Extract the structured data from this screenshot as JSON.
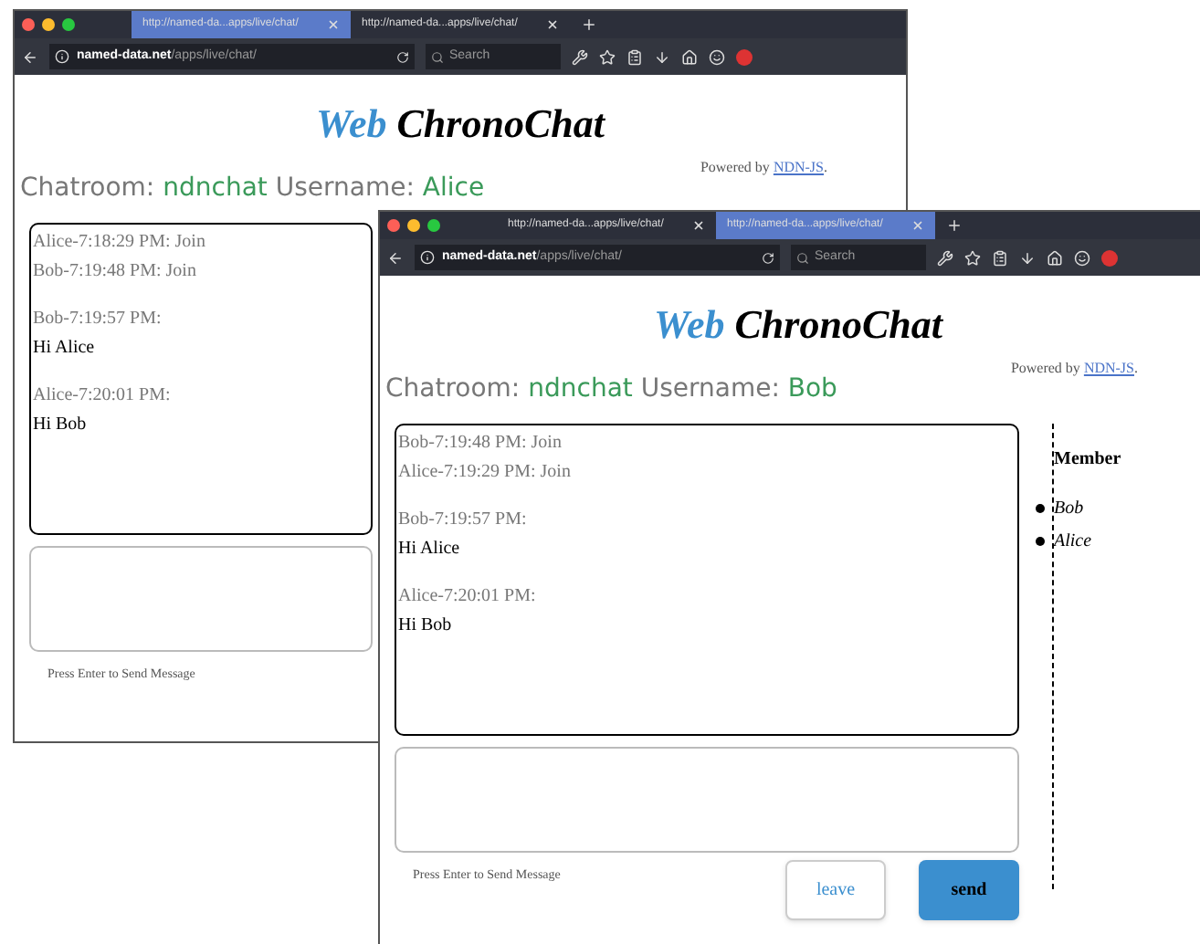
{
  "windows": [
    {
      "tabs": [
        {
          "label": "http://named-da...apps/live/chat/",
          "selected": true
        },
        {
          "label": "http://named-da...apps/live/chat/",
          "selected": false
        }
      ],
      "url_host": "named-data.net",
      "url_path": "/apps/live/chat/",
      "search": {
        "placeholder": "Search"
      },
      "logo_first": "Web",
      "logo_second": "ChronoChat",
      "powered_by": "Powered by",
      "powered_link": "NDN-JS",
      "powered_end": ".",
      "chatroom_label": "Chatroom:",
      "chatroom": "ndnchat",
      "username_label": "Username:",
      "username": "Alice",
      "messages": [
        {
          "kind": "event",
          "header": "Alice-7:18:29 PM: Join"
        },
        {
          "kind": "event",
          "header": "Bob-7:19:48 PM: Join"
        },
        {
          "kind": "chat",
          "header": "Bob-7:19:57 PM:",
          "text": "Hi Alice"
        },
        {
          "kind": "chat",
          "header": "Alice-7:20:01 PM:",
          "text": "Hi Bob"
        }
      ],
      "hint": "Press Enter to Send Message"
    },
    {
      "tabs": [
        {
          "label": "http://named-da...apps/live/chat/",
          "selected": false
        },
        {
          "label": "http://named-da...apps/live/chat/",
          "selected": true
        }
      ],
      "url_host": "named-data.net",
      "url_path": "/apps/live/chat/",
      "search": {
        "placeholder": "Search"
      },
      "logo_first": "Web",
      "logo_second": "ChronoChat",
      "powered_by": "Powered by",
      "powered_link": "NDN-JS",
      "powered_end": ".",
      "chatroom_label": "Chatroom:",
      "chatroom": "ndnchat",
      "username_label": "Username:",
      "username": "Bob",
      "messages": [
        {
          "kind": "event",
          "header": "Bob-7:19:48 PM: Join"
        },
        {
          "kind": "event",
          "header": "Alice-7:19:29 PM: Join"
        },
        {
          "kind": "chat",
          "header": "Bob-7:19:57 PM:",
          "text": "Hi Alice"
        },
        {
          "kind": "chat",
          "header": "Alice-7:20:01 PM:",
          "text": "Hi Bob"
        }
      ],
      "hint": "Press Enter to Send Message",
      "members_title": "Member",
      "members": [
        "Bob",
        "Alice"
      ],
      "buttons": [
        {
          "kind": "leave",
          "label": "leave"
        },
        {
          "kind": "send",
          "label": "send"
        }
      ]
    }
  ]
}
